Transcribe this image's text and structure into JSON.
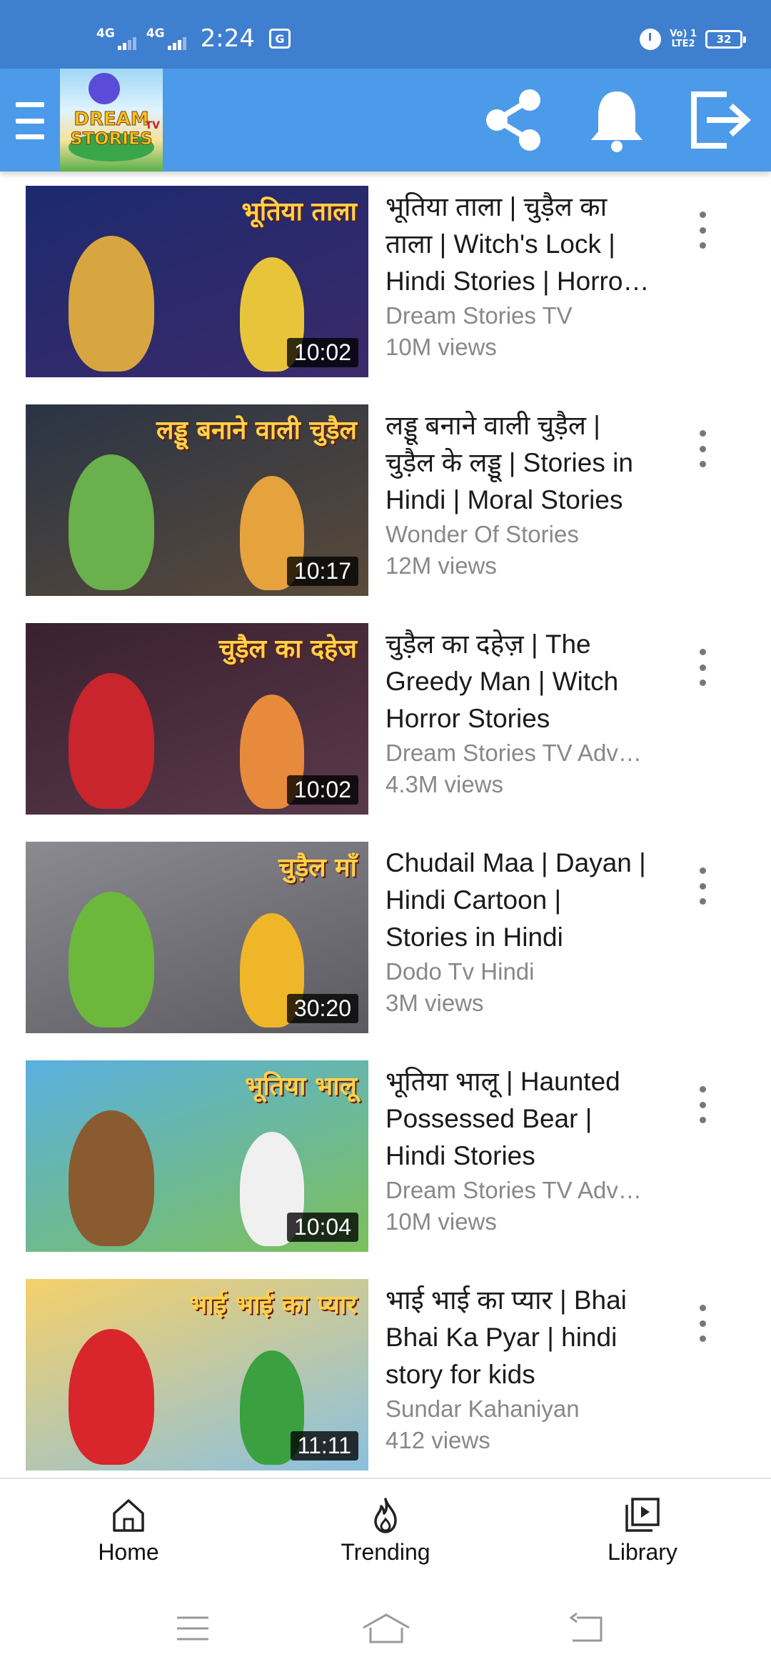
{
  "status_bar": {
    "network1": "4G",
    "network2": "4G",
    "time": "2:24",
    "volte_line1": "Vo) 1",
    "volte_line2": "LTE2",
    "battery": "32"
  },
  "app_bar": {
    "logo_word1": "DREAM",
    "logo_word2": "STORIES",
    "logo_tv": "TV"
  },
  "videos": [
    {
      "title": "भूतिया ताला | चुड़ैल का ताला | Witch's Lock | Hindi Stories | Horror Stories",
      "channel": "Dream Stories TV",
      "views": "10M views",
      "duration": "10:02",
      "thumb_text": "भूतिया ताला",
      "colors": {
        "bg1": "#1c2a6e",
        "bg2": "#3b2a6a",
        "c1": "#d8a640",
        "c2": "#e8c43a"
      }
    },
    {
      "title": "लड्डू बनाने वाली चुड़ैल | चुड़ैल के लड्डू | Stories in Hindi | Moral Stories",
      "channel": "Wonder Of Stories",
      "views": "12M views",
      "duration": "10:17",
      "thumb_text": "लड्डू बनाने वाली चुड़ैल",
      "colors": {
        "bg1": "#2a3445",
        "bg2": "#5a4a3a",
        "c1": "#6ab04c",
        "c2": "#e6a23c"
      }
    },
    {
      "title": "चुड़ैल का दहेज़ | The Greedy Man | Witch Horror Stories",
      "channel": "Dream Stories TV Adventures",
      "views": "4.3M views",
      "duration": "10:02",
      "thumb_text": "चुड़ैल का दहेज",
      "colors": {
        "bg1": "#3a2030",
        "bg2": "#5a3a4a",
        "c1": "#c8262c",
        "c2": "#e88a3c"
      }
    },
    {
      "title": "Chudail Maa | Dayan | Hindi Cartoon | Stories in Hindi",
      "channel": "Dodo Tv Hindi",
      "views": "3M views",
      "duration": "30:20",
      "thumb_text": "चुड़ैल माँ",
      "colors": {
        "bg1": "#8a8a90",
        "bg2": "#5a5a60",
        "c1": "#6cb83c",
        "c2": "#f0b62a"
      }
    },
    {
      "title": "भूतिया भालू | Haunted Possessed Bear | Hindi Stories",
      "channel": "Dream Stories TV Adventures",
      "views": "10M views",
      "duration": "10:04",
      "thumb_text": "भूतिया भालू",
      "colors": {
        "bg1": "#5ab0e0",
        "bg2": "#7cc05a",
        "c1": "#8a5a30",
        "c2": "#f0f0f0"
      }
    },
    {
      "title": "भाई भाई का प्यार | Bhai Bhai Ka Pyar | hindi story for kids",
      "channel": "Sundar Kahaniyan",
      "views": "412 views",
      "duration": "11:11",
      "thumb_text": "भाई भाई का प्यार",
      "colors": {
        "bg1": "#f5d06a",
        "bg2": "#8ac0e0",
        "c1": "#d8262c",
        "c2": "#3aa040"
      }
    }
  ],
  "bottom_nav": {
    "home": "Home",
    "trending": "Trending",
    "library": "Library"
  }
}
